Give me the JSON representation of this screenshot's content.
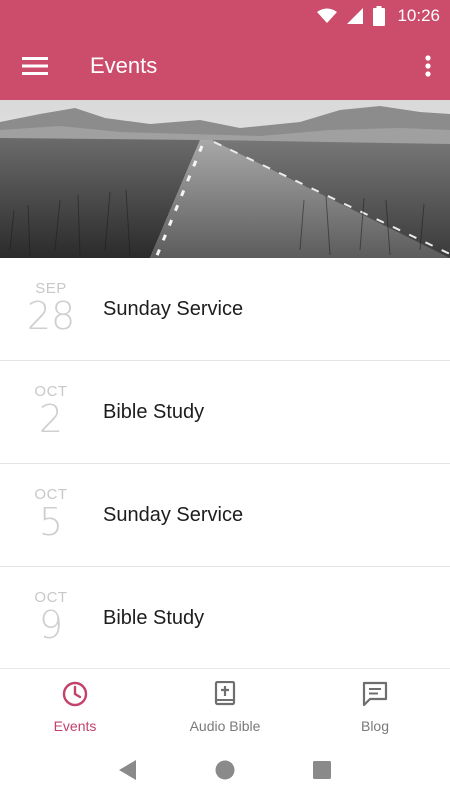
{
  "status_bar": {
    "time": "10:26",
    "icons": [
      "wifi-icon",
      "cell-signal-icon",
      "battery-icon"
    ]
  },
  "app_bar": {
    "title": "Events",
    "menu_icon": "hamburger-menu-icon",
    "overflow_icon": "more-vertical-icon"
  },
  "hero": {
    "image": "black-and-white road through grassland"
  },
  "events": [
    {
      "month": "SEP",
      "day": "28",
      "title": "Sunday Service"
    },
    {
      "month": "OCT",
      "day": "2",
      "title": "Bible Study"
    },
    {
      "month": "OCT",
      "day": "5",
      "title": "Sunday Service"
    },
    {
      "month": "OCT",
      "day": "9",
      "title": "Bible Study"
    }
  ],
  "bottom_nav": [
    {
      "label": "Events",
      "icon": "clock-icon",
      "active": true
    },
    {
      "label": "Audio Bible",
      "icon": "bible-icon",
      "active": false
    },
    {
      "label": "Blog",
      "icon": "comment-icon",
      "active": false
    }
  ],
  "colors": {
    "primary": "#cc4d6b",
    "active_nav": "#c2426a",
    "inactive_nav": "#7a7a7a",
    "date_text": "#c8c8c8"
  }
}
